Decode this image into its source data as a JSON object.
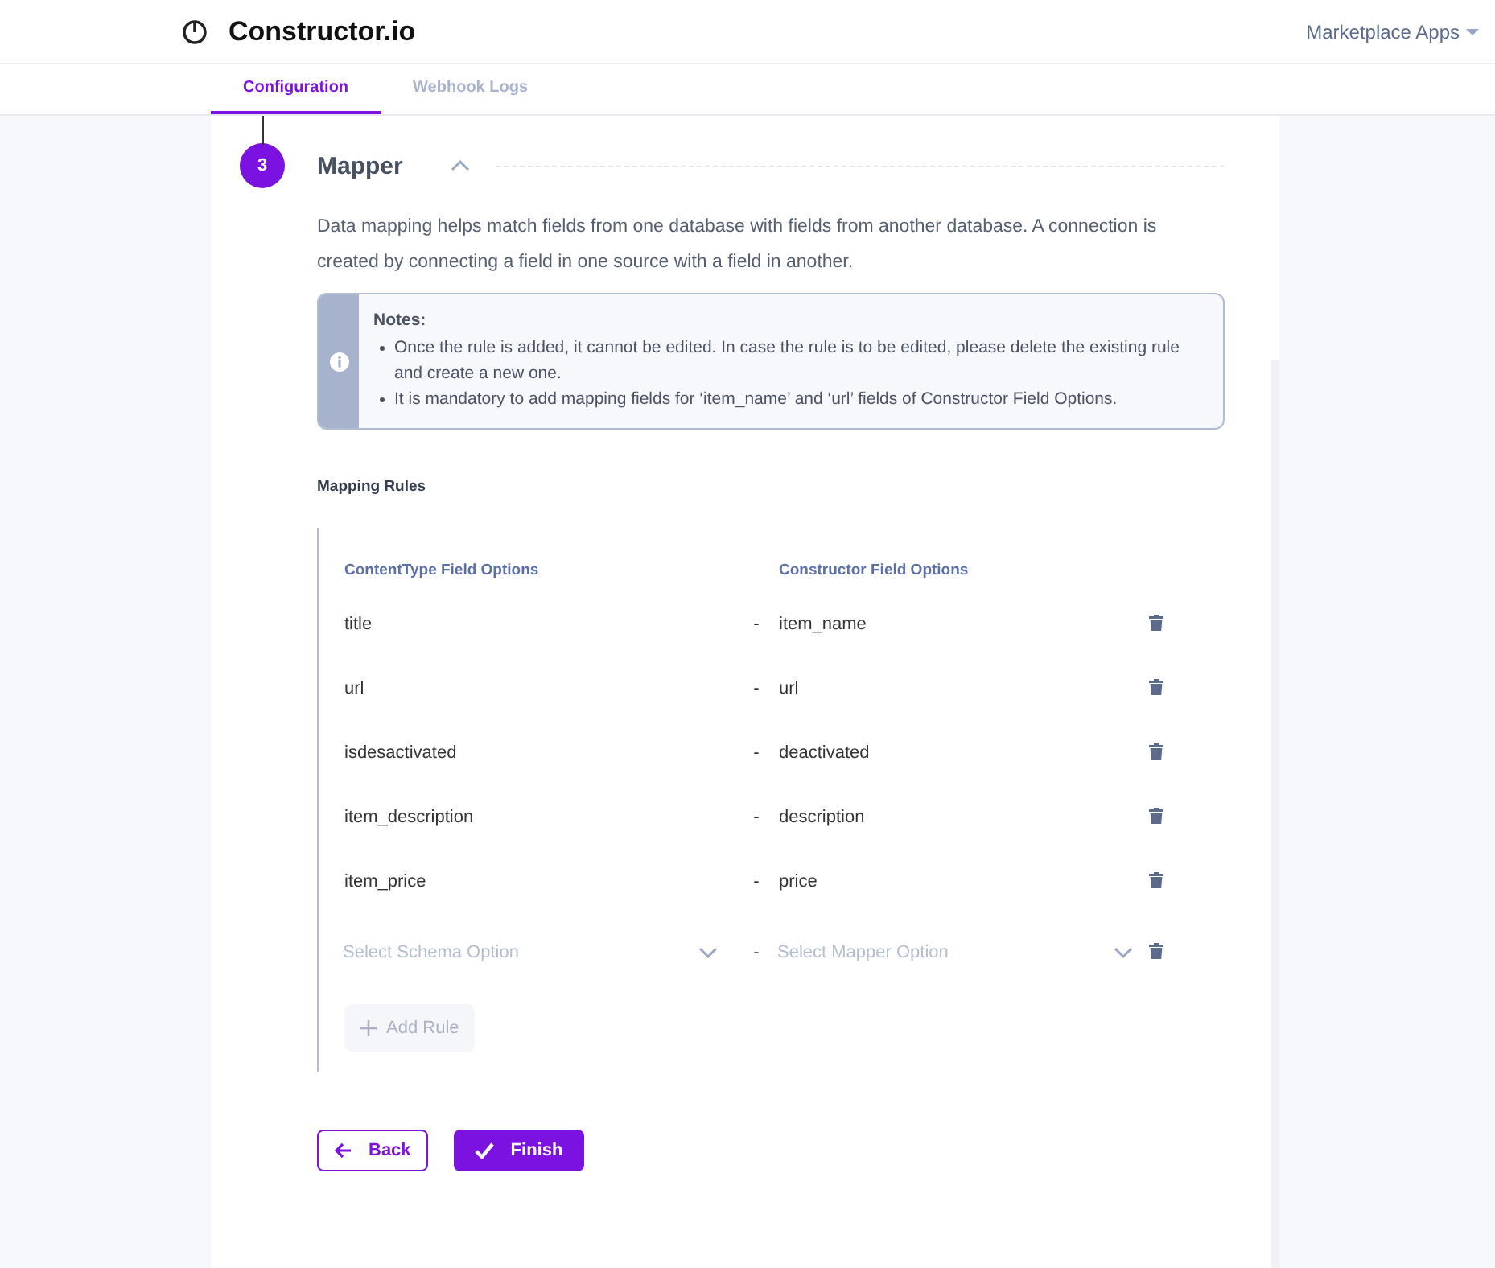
{
  "header": {
    "brand": "Constructor.io",
    "menu": "Marketplace Apps"
  },
  "tabs": [
    {
      "label": "Configuration",
      "selected": true
    },
    {
      "label": "Webhook Logs",
      "selected": false
    }
  ],
  "step": {
    "number": "3",
    "title": "Mapper",
    "expanded": true,
    "description": "Data mapping helps match fields from one database with fields from another database. A connection is created by connecting a field in one source with a field in another."
  },
  "notes": {
    "title": "Notes:",
    "items": [
      "Once the rule is added, it cannot be edited. In case the rule is to be edited, please delete the existing rule and create a new one.",
      "It is mandatory to add mapping fields for ‘item_name’ and ‘url’ fields of Constructor Field Options."
    ]
  },
  "mapping": {
    "title": "Mapping Rules",
    "columns": [
      "ContentType Field Options",
      "Constructor Field Options"
    ],
    "rows": [
      {
        "source": "title",
        "separator": "-",
        "target": "item_name"
      },
      {
        "source": "url",
        "separator": "-",
        "target": "url"
      },
      {
        "source": "isdesactivated",
        "separator": "-",
        "target": "deactivated"
      },
      {
        "source": "item_description",
        "separator": "-",
        "target": "description"
      },
      {
        "source": "item_price",
        "separator": "-",
        "target": "price"
      }
    ],
    "new_rule": {
      "source_placeholder": "Select Schema Option",
      "separator": "-",
      "target_placeholder": "Select Mapper Option"
    },
    "add_button": {
      "label": "Add Rule",
      "disabled": true
    }
  },
  "buttons": [
    {
      "kind": "back",
      "label": "Back"
    },
    {
      "kind": "finish",
      "label": "Finish"
    }
  ]
}
